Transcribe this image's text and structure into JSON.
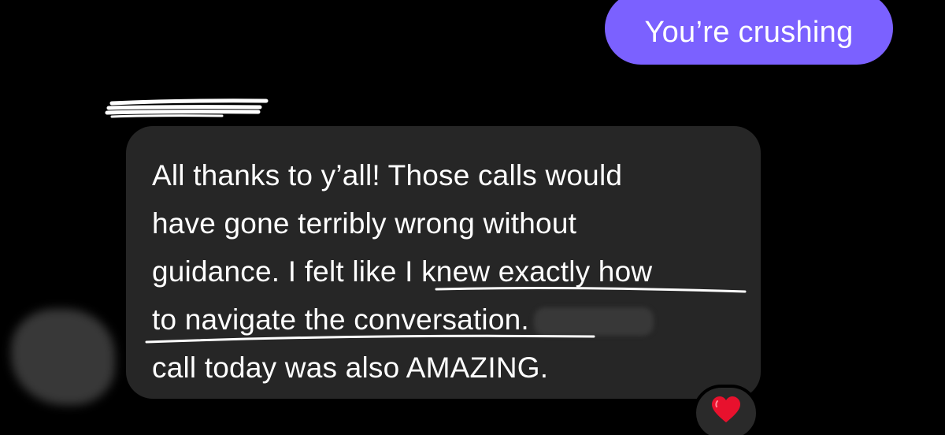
{
  "colors": {
    "background": "#000000",
    "sent_bubble": "#7b61ff",
    "received_bubble": "#262626",
    "text": "#ffffff",
    "redaction": "#383838",
    "reaction_badge": "#2a2a2a",
    "heart": "#e8112d"
  },
  "sent_message": {
    "text": "You’re crushing"
  },
  "received_message": {
    "lines": [
      "All thanks to y’all! Those calls would",
      "have gone terribly wrong without",
      "guidance. I felt like I knew exactly how",
      "to navigate the conversation.",
      "call today was also AMAZING."
    ]
  },
  "reaction": {
    "icon": "heart-icon"
  }
}
